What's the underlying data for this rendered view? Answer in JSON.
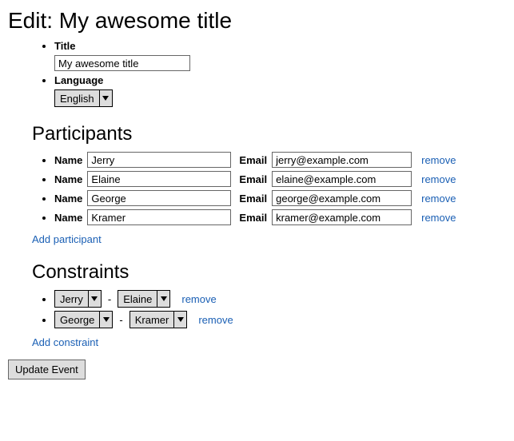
{
  "header": {
    "title": "Edit: My awesome title"
  },
  "fields": {
    "title_label": "Title",
    "title_value": "My awesome title",
    "language_label": "Language",
    "language_value": "English"
  },
  "participants": {
    "heading": "Participants",
    "name_label": "Name",
    "email_label": "Email",
    "remove_label": "remove",
    "add_label": "Add participant",
    "rows": [
      {
        "name": "Jerry",
        "email": "jerry@example.com"
      },
      {
        "name": "Elaine",
        "email": "elaine@example.com"
      },
      {
        "name": "George",
        "email": "george@example.com"
      },
      {
        "name": "Kramer",
        "email": "kramer@example.com"
      }
    ]
  },
  "constraints": {
    "heading": "Constraints",
    "remove_label": "remove",
    "add_label": "Add constraint",
    "rows": [
      {
        "left": "Jerry",
        "right": "Elaine"
      },
      {
        "left": "George",
        "right": "Kramer"
      }
    ]
  },
  "actions": {
    "submit_label": "Update Event"
  }
}
